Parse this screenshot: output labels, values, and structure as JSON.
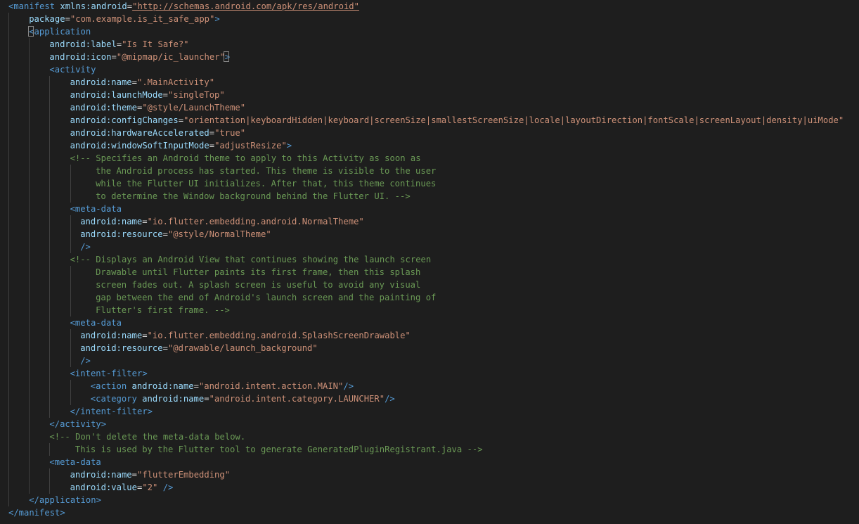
{
  "lines": [
    {
      "indent": 0,
      "tokens": [
        [
          "tag",
          "<manifest "
        ],
        [
          "attr",
          "xmlns:android"
        ],
        [
          "plain",
          "="
        ],
        [
          "url",
          "\"http://schemas.android.com/apk/res/android\""
        ]
      ]
    },
    {
      "indent": 1,
      "tokens": [
        [
          "attr",
          "package"
        ],
        [
          "plain",
          "="
        ],
        [
          "val",
          "\"com.example.is_it_safe_app\""
        ],
        [
          "tag",
          ">"
        ]
      ]
    },
    {
      "indent": 1,
      "tokens": [
        [
          "tag",
          "<application"
        ]
      ],
      "boxFirst": true
    },
    {
      "indent": 2,
      "tokens": [
        [
          "attr",
          "android:label"
        ],
        [
          "plain",
          "="
        ],
        [
          "val",
          "\"Is It Safe?\""
        ]
      ]
    },
    {
      "indent": 2,
      "tokens": [
        [
          "attr",
          "android:icon"
        ],
        [
          "plain",
          "="
        ],
        [
          "val",
          "\"@mipmap/ic_launcher\""
        ],
        [
          "tag",
          ">"
        ]
      ],
      "boxLast": true
    },
    {
      "indent": 2,
      "tokens": [
        [
          "tag",
          "<activity"
        ]
      ]
    },
    {
      "indent": 3,
      "tokens": [
        [
          "attr",
          "android:name"
        ],
        [
          "plain",
          "="
        ],
        [
          "val",
          "\".MainActivity\""
        ]
      ]
    },
    {
      "indent": 3,
      "tokens": [
        [
          "attr",
          "android:launchMode"
        ],
        [
          "plain",
          "="
        ],
        [
          "val",
          "\"singleTop\""
        ]
      ]
    },
    {
      "indent": 3,
      "tokens": [
        [
          "attr",
          "android:theme"
        ],
        [
          "plain",
          "="
        ],
        [
          "val",
          "\"@style/LaunchTheme\""
        ]
      ]
    },
    {
      "indent": 3,
      "tokens": [
        [
          "attr",
          "android:configChanges"
        ],
        [
          "plain",
          "="
        ],
        [
          "val",
          "\"orientation|keyboardHidden|keyboard|screenSize|smallestScreenSize|locale|layoutDirection|fontScale|screenLayout|density|uiMode\""
        ]
      ]
    },
    {
      "indent": 3,
      "tokens": [
        [
          "attr",
          "android:hardwareAccelerated"
        ],
        [
          "plain",
          "="
        ],
        [
          "val",
          "\"true\""
        ]
      ]
    },
    {
      "indent": 3,
      "tokens": [
        [
          "attr",
          "android:windowSoftInputMode"
        ],
        [
          "plain",
          "="
        ],
        [
          "val",
          "\"adjustResize\""
        ],
        [
          "tag",
          ">"
        ]
      ]
    },
    {
      "indent": 3,
      "tokens": [
        [
          "comment",
          "<!-- Specifies an Android theme to apply to this Activity as soon as"
        ]
      ]
    },
    {
      "indent": 3,
      "extra": 5,
      "tokens": [
        [
          "comment",
          "the Android process has started. This theme is visible to the user"
        ]
      ]
    },
    {
      "indent": 3,
      "extra": 5,
      "tokens": [
        [
          "comment",
          "while the Flutter UI initializes. After that, this theme continues"
        ]
      ]
    },
    {
      "indent": 3,
      "extra": 5,
      "tokens": [
        [
          "comment",
          "to determine the Window background behind the Flutter UI. -->"
        ]
      ]
    },
    {
      "indent": 3,
      "tokens": [
        [
          "tag",
          "<meta-data"
        ]
      ]
    },
    {
      "indent": 3,
      "extra": 2,
      "tokens": [
        [
          "attr",
          "android:name"
        ],
        [
          "plain",
          "="
        ],
        [
          "val",
          "\"io.flutter.embedding.android.NormalTheme\""
        ]
      ]
    },
    {
      "indent": 3,
      "extra": 2,
      "tokens": [
        [
          "attr",
          "android:resource"
        ],
        [
          "plain",
          "="
        ],
        [
          "val",
          "\"@style/NormalTheme\""
        ]
      ]
    },
    {
      "indent": 3,
      "extra": 2,
      "tokens": [
        [
          "tag",
          "/>"
        ]
      ]
    },
    {
      "indent": 3,
      "tokens": [
        [
          "comment",
          "<!-- Displays an Android View that continues showing the launch screen"
        ]
      ]
    },
    {
      "indent": 3,
      "extra": 5,
      "tokens": [
        [
          "comment",
          "Drawable until Flutter paints its first frame, then this splash"
        ]
      ]
    },
    {
      "indent": 3,
      "extra": 5,
      "tokens": [
        [
          "comment",
          "screen fades out. A splash screen is useful to avoid any visual"
        ]
      ]
    },
    {
      "indent": 3,
      "extra": 5,
      "tokens": [
        [
          "comment",
          "gap between the end of Android's launch screen and the painting of"
        ]
      ]
    },
    {
      "indent": 3,
      "extra": 5,
      "tokens": [
        [
          "comment",
          "Flutter's first frame. -->"
        ]
      ]
    },
    {
      "indent": 3,
      "tokens": [
        [
          "tag",
          "<meta-data"
        ]
      ]
    },
    {
      "indent": 3,
      "extra": 2,
      "tokens": [
        [
          "attr",
          "android:name"
        ],
        [
          "plain",
          "="
        ],
        [
          "val",
          "\"io.flutter.embedding.android.SplashScreenDrawable\""
        ]
      ]
    },
    {
      "indent": 3,
      "extra": 2,
      "tokens": [
        [
          "attr",
          "android:resource"
        ],
        [
          "plain",
          "="
        ],
        [
          "val",
          "\"@drawable/launch_background\""
        ]
      ]
    },
    {
      "indent": 3,
      "extra": 2,
      "tokens": [
        [
          "tag",
          "/>"
        ]
      ]
    },
    {
      "indent": 3,
      "tokens": [
        [
          "tag",
          "<intent-filter>"
        ]
      ]
    },
    {
      "indent": 4,
      "tokens": [
        [
          "tag",
          "<action "
        ],
        [
          "attr",
          "android:name"
        ],
        [
          "plain",
          "="
        ],
        [
          "val",
          "\"android.intent.action.MAIN\""
        ],
        [
          "tag",
          "/>"
        ]
      ]
    },
    {
      "indent": 4,
      "tokens": [
        [
          "tag",
          "<category "
        ],
        [
          "attr",
          "android:name"
        ],
        [
          "plain",
          "="
        ],
        [
          "val",
          "\"android.intent.category.LAUNCHER\""
        ],
        [
          "tag",
          "/>"
        ]
      ]
    },
    {
      "indent": 3,
      "tokens": [
        [
          "tag",
          "</intent-filter>"
        ]
      ]
    },
    {
      "indent": 2,
      "tokens": [
        [
          "tag",
          "</activity>"
        ]
      ]
    },
    {
      "indent": 2,
      "tokens": [
        [
          "comment",
          "<!-- Don't delete the meta-data below."
        ]
      ]
    },
    {
      "indent": 2,
      "extra": 5,
      "tokens": [
        [
          "comment",
          "This is used by the Flutter tool to generate GeneratedPluginRegistrant.java -->"
        ]
      ]
    },
    {
      "indent": 2,
      "tokens": [
        [
          "tag",
          "<meta-data"
        ]
      ]
    },
    {
      "indent": 3,
      "tokens": [
        [
          "attr",
          "android:name"
        ],
        [
          "plain",
          "="
        ],
        [
          "val",
          "\"flutterEmbedding\""
        ]
      ]
    },
    {
      "indent": 3,
      "tokens": [
        [
          "attr",
          "android:value"
        ],
        [
          "plain",
          "="
        ],
        [
          "val",
          "\"2\""
        ],
        [
          "plain",
          " "
        ],
        [
          "tag",
          "/>"
        ]
      ]
    },
    {
      "indent": 1,
      "tokens": [
        [
          "tag",
          "</application>"
        ]
      ]
    },
    {
      "indent": 0,
      "tokens": [
        [
          "tag",
          "</manifest>"
        ]
      ]
    }
  ]
}
